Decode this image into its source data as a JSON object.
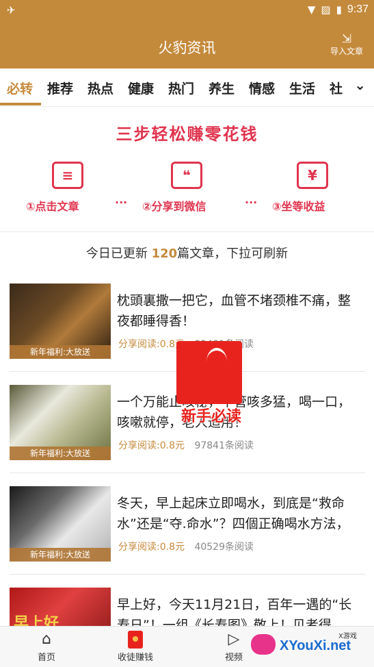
{
  "status_bar": {
    "time": "9:37",
    "icons": [
      "notification-icon",
      "wifi-icon",
      "no-sim-icon",
      "battery-icon"
    ]
  },
  "header": {
    "title": "火豹资讯",
    "import_label": "导入文章",
    "import_icon": "import-icon"
  },
  "tabs": [
    "必转",
    "推荐",
    "热点",
    "健康",
    "热门",
    "养生",
    "情感",
    "生活",
    "社"
  ],
  "active_tab": "必转",
  "banner": {
    "title": "三步轻松赚零花钱",
    "steps": [
      {
        "label": "①点击文章",
        "icon": "article-icon"
      },
      {
        "label": "②分享到微信",
        "icon": "wechat-icon"
      },
      {
        "label": "③坐等收益",
        "icon": "yuan-icon"
      }
    ],
    "dots": "···"
  },
  "update": {
    "prefix": "今日已更新",
    "count": "120",
    "suffix": "篇文章，下拉可刷新"
  },
  "articles": [
    {
      "headline": "枕頭裏撒一把它，血管不堵颈椎不痛，整夜都睡得香！",
      "tag": "新年福利:大放送",
      "share": "分享阅读:0.8元",
      "reads": "32481条阅读"
    },
    {
      "headline": "一个万能止咳秘，不管咳多猛，喝一口，咳嗽就停，老人适用！",
      "tag": "新年福利:大放送",
      "share": "分享阅读:0.8元",
      "reads": "97841条阅读"
    },
    {
      "headline": "冬天，早上起床立即喝水，到底是“救命水”还是“夺.命水”？四個正确喝水方法，",
      "tag": "新年福利:大放送",
      "share": "分享阅读:0.8元",
      "reads": "40529条阅读"
    },
    {
      "headline": "早上好，今天11月21日，百年一遇的“长寿日”！一组《长寿图》敬上！见者得",
      "tag": "早上好",
      "share": "",
      "reads": ""
    }
  ],
  "overlay": {
    "label": "新手必读",
    "icon": "open-book-icon"
  },
  "bottom_nav": [
    {
      "label": "首页",
      "icon": "home-icon"
    },
    {
      "label": "收徒赚钱",
      "icon": "red-packet-icon"
    },
    {
      "label": "视频",
      "icon": "play-icon"
    }
  ],
  "watermark": {
    "brand": "XYouXi.net",
    "small": "X游戏"
  },
  "colors": {
    "brand": "#c48a3c",
    "accent_red": "#e0344e",
    "badge_red": "#e8231e"
  }
}
